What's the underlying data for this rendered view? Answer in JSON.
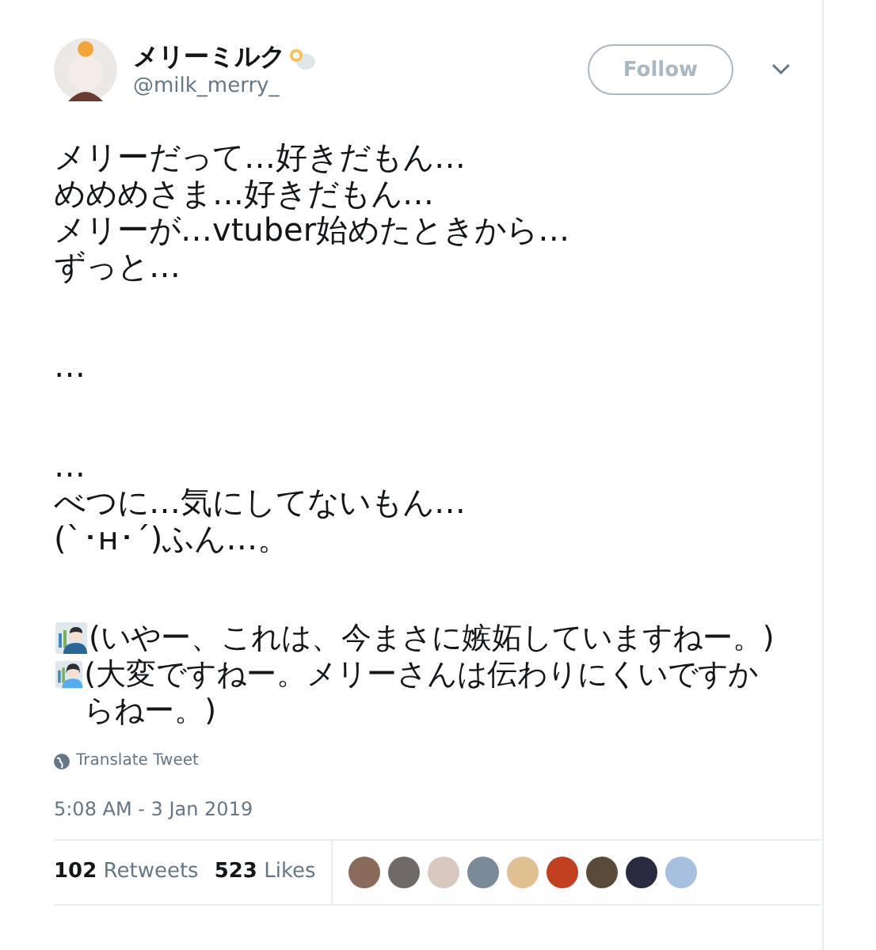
{
  "author": {
    "name": "メリーミルク",
    "handle": "@milk_merry_"
  },
  "follow_button": {
    "label": "Follow"
  },
  "body": [
    {
      "lines": [
        {
          "kind": "text",
          "text": "メリーだって…好きだもん…"
        },
        {
          "kind": "text",
          "text": "めめめさま…好きだもん…"
        },
        {
          "kind": "text",
          "text": "メリーが…vtuber始めたときから…"
        },
        {
          "kind": "text",
          "text": "ずっと…"
        }
      ]
    },
    {
      "lines": [
        {
          "kind": "text",
          "text": "…"
        }
      ]
    },
    {
      "lines": [
        {
          "kind": "text",
          "text": "…"
        },
        {
          "kind": "text",
          "text": "べつに…気にしてないもん…"
        },
        {
          "kind": "text",
          "text": "(`･н･´)ふん…。"
        }
      ]
    },
    {
      "lines": [
        {
          "kind": "man-worker",
          "text": "(いやー、これは、今まさに嫉妬していますねー。)"
        },
        {
          "kind": "woman-worker",
          "text": "(大変ですねー。メリーさんは伝わりにくいですからねー。)"
        }
      ]
    }
  ],
  "translate_link": "Translate Tweet",
  "timestamp": "5:08 AM - 3 Jan 2019",
  "stats": [
    {
      "count": "102",
      "label": "Retweets"
    },
    {
      "count": "523",
      "label": "Likes"
    }
  ],
  "likers": [
    {
      "color": "#8a6a5a"
    },
    {
      "color": "#6f6a68"
    },
    {
      "color": "#d8c8c0"
    },
    {
      "color": "#7b8a98"
    },
    {
      "color": "#e0c090"
    },
    {
      "color": "#c04020"
    },
    {
      "color": "#5a4a3a"
    },
    {
      "color": "#2a2a40"
    },
    {
      "color": "#a8c0e0"
    }
  ]
}
